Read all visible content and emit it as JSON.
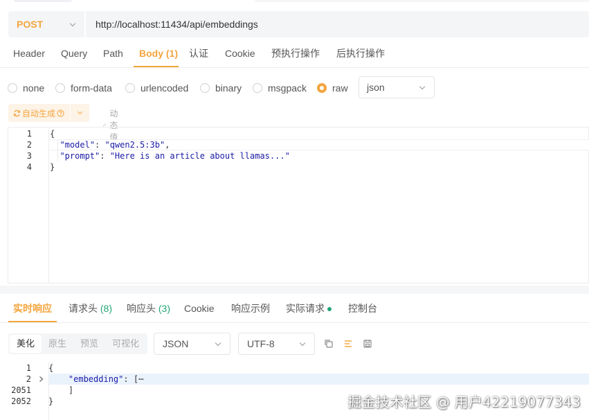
{
  "request": {
    "method": "POST",
    "url": "http://localhost:11434/api/embeddings"
  },
  "request_tabs": [
    {
      "label": "Header"
    },
    {
      "label": "Query"
    },
    {
      "label": "Path"
    },
    {
      "label": "Body",
      "count": "(1)"
    },
    {
      "label": "认证"
    },
    {
      "label": "Cookie"
    },
    {
      "label": "预执行操作"
    },
    {
      "label": "后执行操作"
    }
  ],
  "body_types": [
    "none",
    "form-data",
    "urlencoded",
    "binary",
    "msgpack",
    "raw"
  ],
  "body_format": "json",
  "auto_generate_label": "自动生成",
  "dynamic_value_label": "动态值",
  "request_code": {
    "line_numbers": [
      "1",
      "2",
      "3",
      "4"
    ],
    "line1": "{",
    "l2_key": "\"model\"",
    "l2_val": "\"qwen2.5:3b\"",
    "l3_key": "\"prompt\"",
    "l3_val": "\"Here is an article about llamas...\"",
    "line4": "}"
  },
  "response_tabs": [
    {
      "label": "实时响应"
    },
    {
      "label": "请求头",
      "count": "(8)"
    },
    {
      "label": "响应头",
      "count": "(3)"
    },
    {
      "label": "Cookie"
    },
    {
      "label": "响应示例"
    },
    {
      "label": "实际请求"
    },
    {
      "label": "控制台"
    }
  ],
  "response_view_modes": [
    "美化",
    "原生",
    "预览",
    "可视化"
  ],
  "response_format": "JSON",
  "response_encoding": "UTF-8",
  "response_code": {
    "line_numbers": [
      "1",
      "2",
      "2051",
      "2052"
    ],
    "line1": "{",
    "l2_key": "\"embedding\"",
    "l2_rest": ": [",
    "l2_fold": "⋯",
    "line3": "]",
    "line4": "}"
  },
  "watermark": "掘金技术社区 @ 用户42219077343",
  "colors": {
    "accent": "#f4a53e",
    "green": "#21a675"
  }
}
